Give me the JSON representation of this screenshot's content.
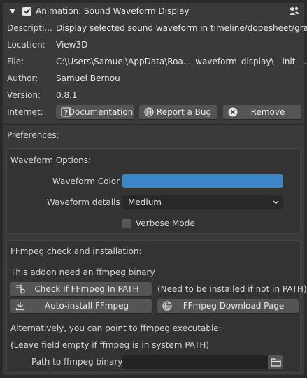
{
  "addon": {
    "title": "Animation: Sound Waveform Display",
    "enabled": true,
    "fields": [
      {
        "label": "Descripti...",
        "value": "Display selected sound waveform in timeline/dopesheet/graph"
      },
      {
        "label": "Location:",
        "value": "View3D"
      },
      {
        "label": "File:",
        "value": "C:\\Users\\Samuel\\AppData\\Roa..._waveform_display\\__init__.py"
      },
      {
        "label": "Author:",
        "value": "Samuel Bernou"
      },
      {
        "label": "Version:",
        "value": "0.8.1"
      }
    ],
    "internet_label": "Internet:",
    "buttons": {
      "documentation": "Documentation",
      "report_bug": "Report a Bug",
      "remove": "Remove"
    },
    "icons": {
      "header": "user-icon",
      "documentation": "help-icon",
      "report_bug": "globe-icon",
      "remove": "close-circle-icon"
    }
  },
  "preferences": {
    "title": "Preferences:",
    "waveform": {
      "title": "Waveform Options:",
      "color_label": "Waveform Color",
      "color_value": "#3a86c6",
      "details_label": "Waveform details",
      "details_value": "Medium",
      "verbose_label": "Verbose Mode",
      "verbose_checked": false
    },
    "ffmpeg": {
      "title": "FFmpeg check and installation:",
      "note": "This addon need an ffmpeg binary",
      "check_button": "Check If FFmpeg In PATH",
      "check_note": "(Need to be installed if not in PATH)",
      "autoinstall_button": "Auto-install FFmpeg",
      "download_button": "FFmpeg Download Page",
      "alt_text": "Alternatively, you can point to ffmpeg executable:",
      "alt_note": "(Leave field empty if ffmpeg is in system PATH)",
      "path_label": "Path to ffmpeg binary",
      "path_value": ""
    }
  }
}
